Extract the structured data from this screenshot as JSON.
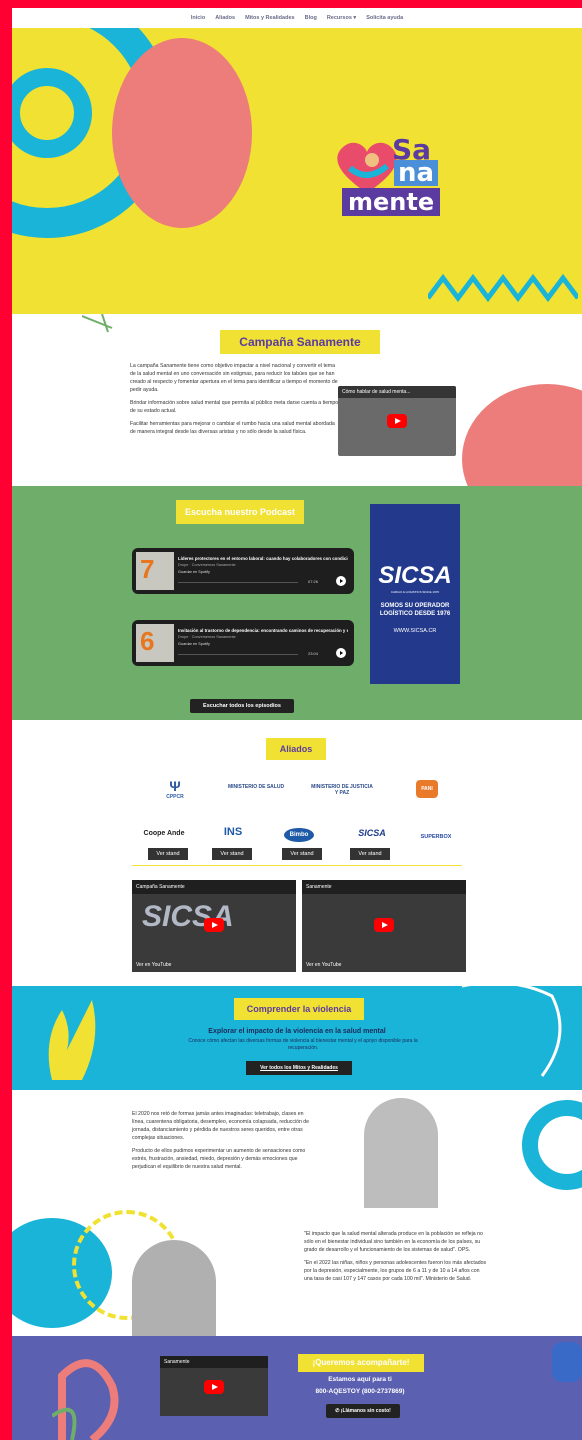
{
  "nav": {
    "items": [
      "Inicio",
      "Aliados",
      "Mitos y Realidades",
      "Blog",
      "Recursos ▾",
      "Solicita ayuda"
    ]
  },
  "hero": {
    "logo_words": [
      "Sa",
      "na",
      "mente"
    ]
  },
  "campaign": {
    "title": "Campaña Sanamente",
    "paragraphs": [
      "La campaña Sanamente tiene como objetivo impactar a nivel nacional y convertir el tema de la salud mental en uno conversación sin estigmas, para reducir los tabúes que se han creado al respecto y fomentar apertura en el tema para identificar a tiempo el momento de pedir ayuda.",
      "Brindar información sobre salud mental que permita al público meta darse cuenta a tiempo de su estado actual.",
      "Facilitar herramientas para mejorar o cambiar el rumbo hacia una salud mental abordada de manera integral desde las diversas aristas y no sólo desde la salud física."
    ],
    "video_title": "Cómo hablar de salud menta..."
  },
  "podcast": {
    "title": "Escucha nuestro Podcast",
    "episodes": [
      {
        "num": "7",
        "title": "Líderes protectores en el entorno laboral: cuando hay colaboradores con condición de sa",
        "show": "Drupe · Conversemos Sanamente",
        "spotify": "Guardar en Spotify",
        "time": "07:26"
      },
      {
        "num": "6",
        "title": "Invitación al trastorno de dependencia: encontrando caminos de recuperación y espera",
        "show": "Drupe · Conversemos Sanamente",
        "spotify": "Guardar en Spotify",
        "time": "23:04"
      }
    ],
    "all_button": "Escuchar todos los episodios",
    "ad": {
      "brand": "SICSA",
      "tagline": "CARGO & LOGISTICS SINCE 1976",
      "headline": "SOMOS SU OPERADOR LOGÍSTICO DESDE 1976",
      "url": "WWW.SICSA.CR"
    }
  },
  "allies": {
    "title": "Aliados",
    "row1": [
      "CPPCR",
      "MINISTERIO DE SALUD",
      "MINISTERIO DE JUSTICIA Y PAZ",
      "PANI"
    ],
    "row2": [
      "Coope Ande",
      "INS",
      "Bimbo",
      "SICSA",
      "SUPERBOX"
    ],
    "stand_label": "Ver stand",
    "videos": [
      {
        "title": "Campaña Sanamente",
        "watch": "Ver en YouTube"
      },
      {
        "title": "Sanamente",
        "watch": "Ver en YouTube"
      }
    ]
  },
  "violence": {
    "title": "Comprender la violencia",
    "heading": "Explorar el impacto de la violencia en la salud mental",
    "text": "Conoce cómo afectan las diversas formas de violencia al bienestar mental y el apoyo disponible para la recuperación.",
    "button": "Ver todos los Mitos y Realidades"
  },
  "stress": {
    "left": [
      "El 2020 nos retó de formas jamás antes imaginadas: teletrabajo, clases en línea, cuarentena obligatoria, desempleo, economía colapsada, reducción de jornada, distanciamiento y pérdida de nuestros seres queridos, entre otras complejas situaciones.",
      "Producto de ellos pudimos experimentar un aumento de sensaciones como estrés, frustración, ansiedad, miedo, depresión y demás emociones que perjudican el equilibrio de nuestra salud mental."
    ],
    "right": [
      "\"El impacto que la salud mental alterada produce en la población se refleja no sólo en el bienestar individual sino también en la economía de los países, su grado de desarrollo y el funcionamiento de los sistemas de salud\". OPS.",
      "\"En el 2022 las niñas, niños y personas adolescentes fueron los más afectados por la depresión, especialmente, los grupos de 6 a 11 y de 10 a 14 años con una tasa de casi 107 y 147 casos por cada 100 mil\". Ministerio de Salud."
    ]
  },
  "contact": {
    "video_title": "Sanamente",
    "heading": "¡Queremos acompañarte!",
    "line1": "Estamos aquí para ti",
    "line2": "800-AQESTOY (800-2737869)",
    "button": "¡Llámanos sin costo!"
  },
  "colors": {
    "yellow": "#f0e133",
    "blue": "#19b4d8",
    "pink": "#ec7d7b",
    "green": "#6fae6a",
    "purple": "#5b3ba0",
    "indigo": "#5c60b0"
  }
}
